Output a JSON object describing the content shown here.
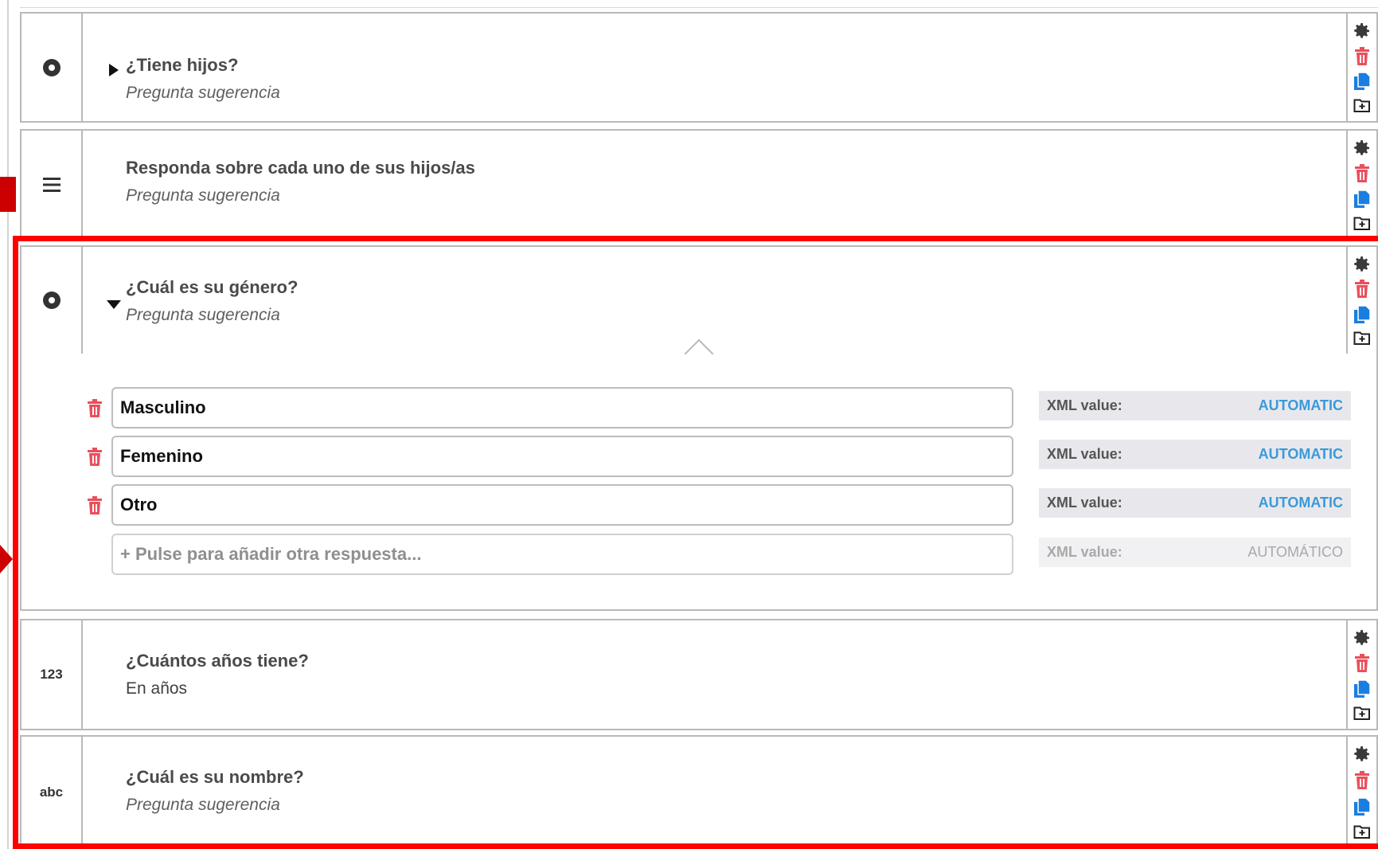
{
  "questions": [
    {
      "type_icon": "radio-icon",
      "label": "¿Tiene hijos?",
      "hint": "Pregunta sugerencia",
      "caret": "right"
    },
    {
      "type_icon": "group-icon",
      "label": "Responda sobre cada uno de sus hijos/as",
      "hint": "Pregunta sugerencia"
    },
    {
      "type_icon": "radio-icon",
      "label": "¿Cuál es su género?",
      "hint": "Pregunta sugerencia",
      "caret": "down"
    },
    {
      "type_icon_text": "123",
      "label": "¿Cuántos años tiene?",
      "hint": "En años"
    },
    {
      "type_icon_text": "abc",
      "label": "¿Cuál es su nombre?",
      "hint": "Pregunta sugerencia"
    }
  ],
  "options": {
    "items": [
      {
        "value": "Masculino",
        "xml_label": "XML value:",
        "xml_value": "AUTOMATIC"
      },
      {
        "value": "Femenino",
        "xml_label": "XML value:",
        "xml_value": "AUTOMATIC"
      },
      {
        "value": "Otro",
        "xml_label": "XML value:",
        "xml_value": "AUTOMATIC"
      }
    ],
    "add": {
      "placeholder": "+ Pulse para añadir otra respuesta...",
      "xml_label": "XML value:",
      "xml_value": "AUTOMÁTICO"
    }
  },
  "colors": {
    "trash": "#e8505b",
    "copy": "#1a7ee0",
    "settings": "#3a3a3a",
    "highlight": "#ff0000",
    "xml_value": "#3a9ad9"
  },
  "action_icons": [
    "gear-icon",
    "trash-icon",
    "copy-icon",
    "add-to-folder-icon"
  ]
}
